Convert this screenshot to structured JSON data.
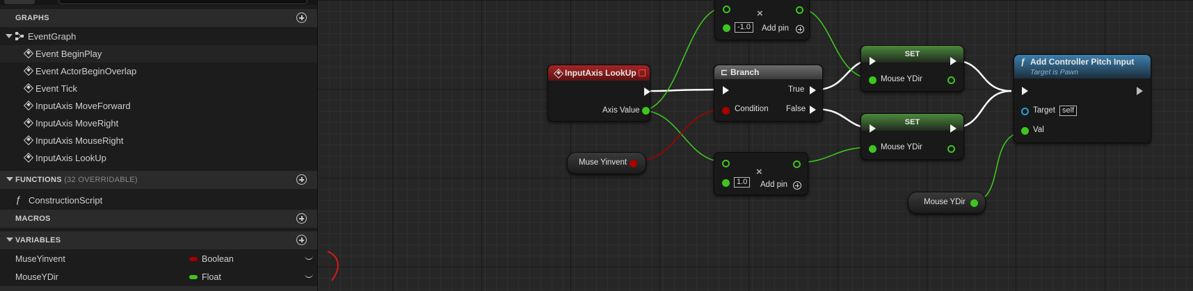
{
  "sidebar": {
    "sections": {
      "graphs": {
        "title": "GRAPHS"
      },
      "functions": {
        "title": "FUNCTIONS",
        "sub": "(32 OVERRIDABLE)"
      },
      "macros": {
        "title": "MACROS"
      },
      "variables": {
        "title": "VARIABLES"
      }
    },
    "event_graph": "EventGraph",
    "events": [
      "Event BeginPlay",
      "Event ActorBeginOverlap",
      "Event Tick",
      "InputAxis MoveForward",
      "InputAxis MoveRight",
      "InputAxis MouseRight",
      "InputAxis LookUp"
    ],
    "functions": [
      "ConstructionScript"
    ],
    "variables": [
      {
        "name": "MuseYinvent",
        "type": "Boolean",
        "color": "#a30000"
      },
      {
        "name": "MouseYDir",
        "type": "Float",
        "color": "#3fc51f"
      }
    ]
  },
  "graph": {
    "input_axis": {
      "title": "InputAxis LookUp",
      "axis_value": "Axis Value"
    },
    "branch": {
      "title": "Branch",
      "condition": "Condition",
      "true": "True",
      "false": "False"
    },
    "multiply_top": {
      "value": "-1.0",
      "add_pin": "Add pin"
    },
    "multiply_bottom": {
      "value": "1.0",
      "add_pin": "Add pin"
    },
    "set_top": {
      "title": "SET",
      "var": "Mouse YDir"
    },
    "set_bottom": {
      "title": "SET",
      "var": "Mouse YDir"
    },
    "getter_bool": {
      "label": "Muse Yinvent"
    },
    "getter_float": {
      "label": "Mouse YDir"
    },
    "pitch": {
      "title": "Add Controller Pitch Input",
      "subtitle": "Target is Pawn",
      "target": "Target",
      "target_value": "self",
      "val": "Val"
    }
  },
  "colors": {
    "exec": "#ffffff",
    "float": "#3fc51f",
    "bool": "#a30000",
    "event_header": "#8b1a1a",
    "set_header": "#3d6b34",
    "function_header": "#2b5f86"
  }
}
